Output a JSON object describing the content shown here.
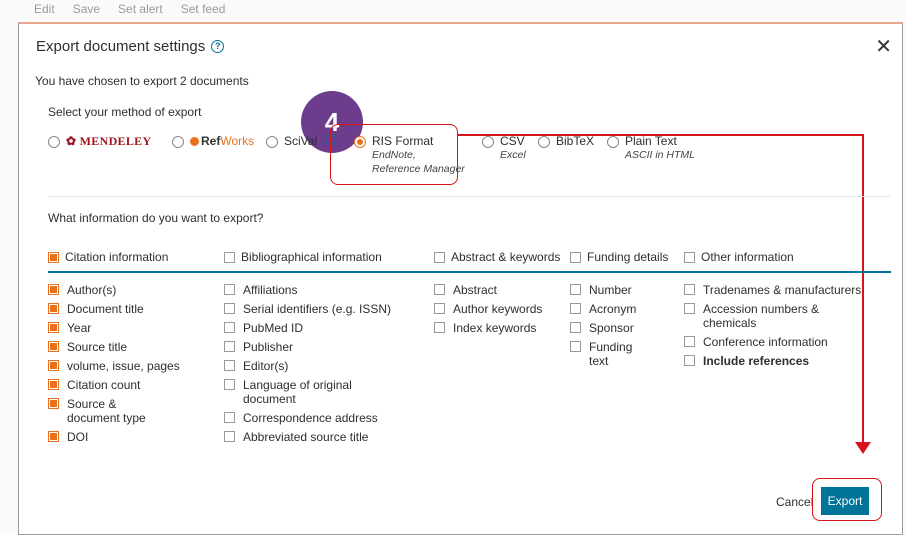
{
  "background": {
    "toolbar": [
      "Edit",
      "Save",
      "Set alert",
      "Set feed"
    ]
  },
  "dialog": {
    "title": "Export document settings",
    "chosen_text": "You have chosen to export 2 documents",
    "select_method_label": "Select your method of export",
    "step_number": "4",
    "methods": [
      {
        "label": "MENDELEY",
        "selected": false
      },
      {
        "label_ref": "Ref",
        "label_works": "Works",
        "selected": false
      },
      {
        "label": "SciVal",
        "selected": false
      },
      {
        "label": "RIS Format",
        "sub": [
          "EndNote,",
          "Reference Manager"
        ],
        "selected": true
      },
      {
        "label": "CSV",
        "sub": [
          "Excel"
        ],
        "selected": false
      },
      {
        "label": "BibTeX",
        "selected": false
      },
      {
        "label": "Plain Text",
        "sub": [
          "ASCII in HTML"
        ],
        "selected": false
      }
    ],
    "what_info_label": "What information do you want to export?",
    "categories": [
      {
        "label": "Citation information",
        "checked": true
      },
      {
        "label": "Bibliographical information",
        "checked": false
      },
      {
        "label": "Abstract & keywords",
        "checked": false
      },
      {
        "label": "Funding details",
        "checked": false
      },
      {
        "label": "Other information",
        "checked": false
      }
    ],
    "columns": {
      "citation": [
        {
          "label": "Author(s)",
          "checked": true
        },
        {
          "label": "Document title",
          "checked": true
        },
        {
          "label": "Year",
          "checked": true
        },
        {
          "label": "Source title",
          "checked": true
        },
        {
          "label": "volume, issue, pages",
          "checked": true
        },
        {
          "label": "Citation count",
          "checked": true
        },
        {
          "label": "Source & document type",
          "checked": true
        },
        {
          "label": "DOI",
          "checked": true
        }
      ],
      "bibliographical": [
        {
          "label": "Affiliations",
          "checked": false
        },
        {
          "label": "Serial identifiers (e.g. ISSN)",
          "checked": false
        },
        {
          "label": "PubMed ID",
          "checked": false
        },
        {
          "label": "Publisher",
          "checked": false
        },
        {
          "label": "Editor(s)",
          "checked": false
        },
        {
          "label": "Language of original document",
          "checked": false
        },
        {
          "label": "Correspondence address",
          "checked": false
        },
        {
          "label": "Abbreviated source title",
          "checked": false
        }
      ],
      "abstract": [
        {
          "label": "Abstract",
          "checked": false
        },
        {
          "label": "Author keywords",
          "checked": false
        },
        {
          "label": "Index keywords",
          "checked": false
        }
      ],
      "funding": [
        {
          "label": "Number",
          "checked": false
        },
        {
          "label": "Acronym",
          "checked": false
        },
        {
          "label": "Sponsor",
          "checked": false
        },
        {
          "label": "Funding text",
          "checked": false
        }
      ],
      "other": [
        {
          "label": "Tradenames & manufacturers",
          "checked": false
        },
        {
          "label": "Accession numbers & chemicals",
          "checked": false
        },
        {
          "label": "Conference information",
          "checked": false
        },
        {
          "label": "Include references",
          "checked": false,
          "bold": true
        }
      ]
    },
    "cancel_label": "Cancel",
    "export_label": "Export"
  },
  "colors": {
    "accent_blue": "#007398",
    "check_orange": "#e9711c",
    "annotation_red": "#d7141a",
    "step_badge_purple": "#6c3d8c"
  },
  "icons": [
    "help-icon",
    "close-icon",
    "mendeley-logo-icon",
    "refworks-logo-icon",
    "scival-info-icon"
  ]
}
